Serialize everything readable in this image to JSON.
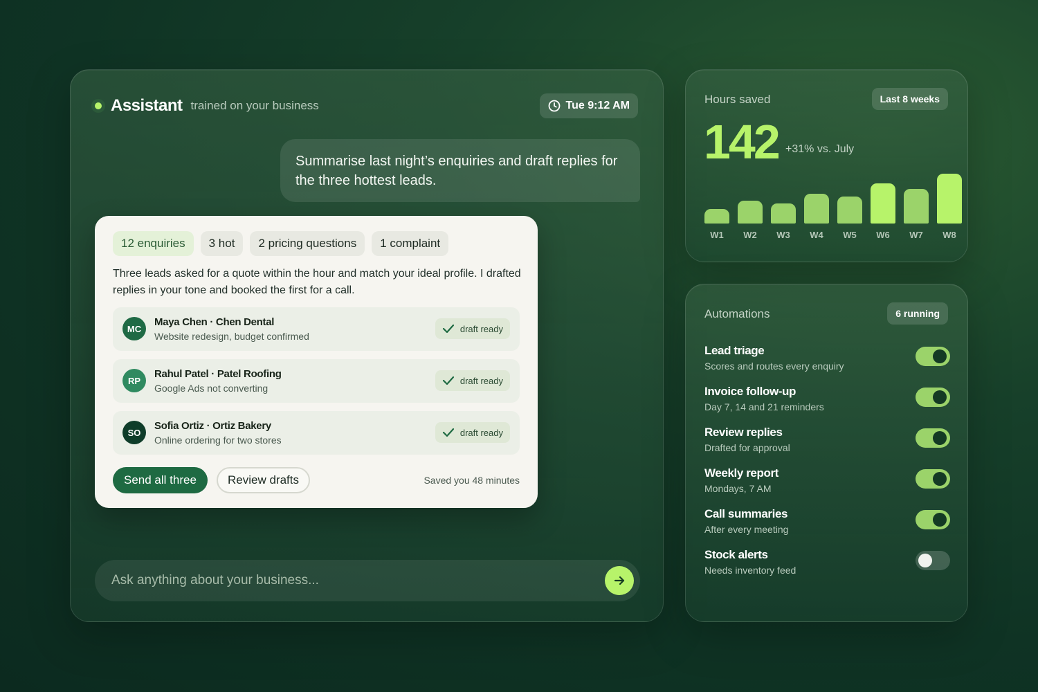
{
  "assistant": {
    "title": "Assistant",
    "subtitle": "trained on your business",
    "time": "Tue 9:12 AM",
    "user_message": "Summarise last night’s enquiries and draft replies for the three hottest leads.",
    "reply": {
      "chips": [
        "12 enquiries",
        "3 hot",
        "2 pricing questions",
        "1 complaint"
      ],
      "summary": "Three leads asked for a quote within the hour and match your ideal profile. I drafted replies in your tone and booked the first for a call.",
      "leads": [
        {
          "initials": "MC",
          "name": "Maya Chen · Chen Dental",
          "desc": "Website redesign, budget confirmed",
          "status": "draft ready",
          "avatar_color": "#1f6a45"
        },
        {
          "initials": "RP",
          "name": "Rahul Patel · Patel Roofing",
          "desc": "Google Ads not converting",
          "status": "draft ready",
          "avatar_color": "#2f8a60"
        },
        {
          "initials": "SO",
          "name": "Sofia Ortiz · Ortiz Bakery",
          "desc": "Online ordering for two stores",
          "status": "draft ready",
          "avatar_color": "#0f3d2a"
        }
      ],
      "primary_button": "Send all three",
      "secondary_button": "Review drafts",
      "saved_note": "Saved you 48 minutes"
    },
    "input_placeholder": "Ask anything about your business..."
  },
  "hours": {
    "title": "Hours saved",
    "range": "Last 8 weeks",
    "value": "142",
    "delta": "+31% vs. July"
  },
  "chart_data": {
    "type": "bar",
    "categories": [
      "W1",
      "W2",
      "W3",
      "W4",
      "W5",
      "W6",
      "W7",
      "W8"
    ],
    "values": [
      20,
      32,
      28,
      42,
      38,
      56,
      49,
      70
    ],
    "ylim": [
      0,
      70
    ],
    "colors": {
      "bar": "#9bd36a",
      "highlight": "#b7f36a"
    }
  },
  "automations": {
    "title": "Automations",
    "running": "6 running",
    "items": [
      {
        "name": "Lead triage",
        "desc": "Scores and routes every enquiry",
        "on": true
      },
      {
        "name": "Invoice follow-up",
        "desc": "Day 7, 14 and 21 reminders",
        "on": true
      },
      {
        "name": "Review replies",
        "desc": "Drafted for approval",
        "on": true
      },
      {
        "name": "Weekly report",
        "desc": "Mondays, 7 AM",
        "on": true
      },
      {
        "name": "Call summaries",
        "desc": "After every meeting",
        "on": true
      },
      {
        "name": "Stock alerts",
        "desc": "Needs inventory feed",
        "on": false
      }
    ]
  },
  "icons": {
    "clock": "clock-icon",
    "check": "check-icon",
    "send": "arrow-right-icon"
  },
  "colors": {
    "accent": "#b7f36a",
    "primary_button": "#1e6a42"
  }
}
